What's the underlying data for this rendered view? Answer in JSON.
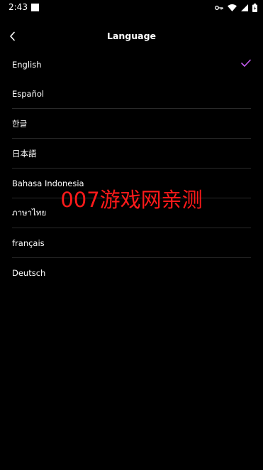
{
  "status_bar": {
    "time": "2:43"
  },
  "header": {
    "title": "Language"
  },
  "languages": [
    {
      "label": "English",
      "selected": true
    },
    {
      "label": "Español",
      "selected": false
    },
    {
      "label": "한글",
      "selected": false
    },
    {
      "label": "日本語",
      "selected": false
    },
    {
      "label": "Bahasa Indonesia",
      "selected": false
    },
    {
      "label": "ภาษาไทย",
      "selected": false
    },
    {
      "label": "français",
      "selected": false
    },
    {
      "label": "Deutsch",
      "selected": false
    }
  ],
  "watermark": "007游戏网亲测",
  "colors": {
    "background": "#000000",
    "accent": "#c45cf0",
    "divider": "#2a2a2a",
    "watermark": "#ff1a1a"
  },
  "icons": {
    "back": "chevron-left-icon",
    "selected": "check-icon"
  }
}
